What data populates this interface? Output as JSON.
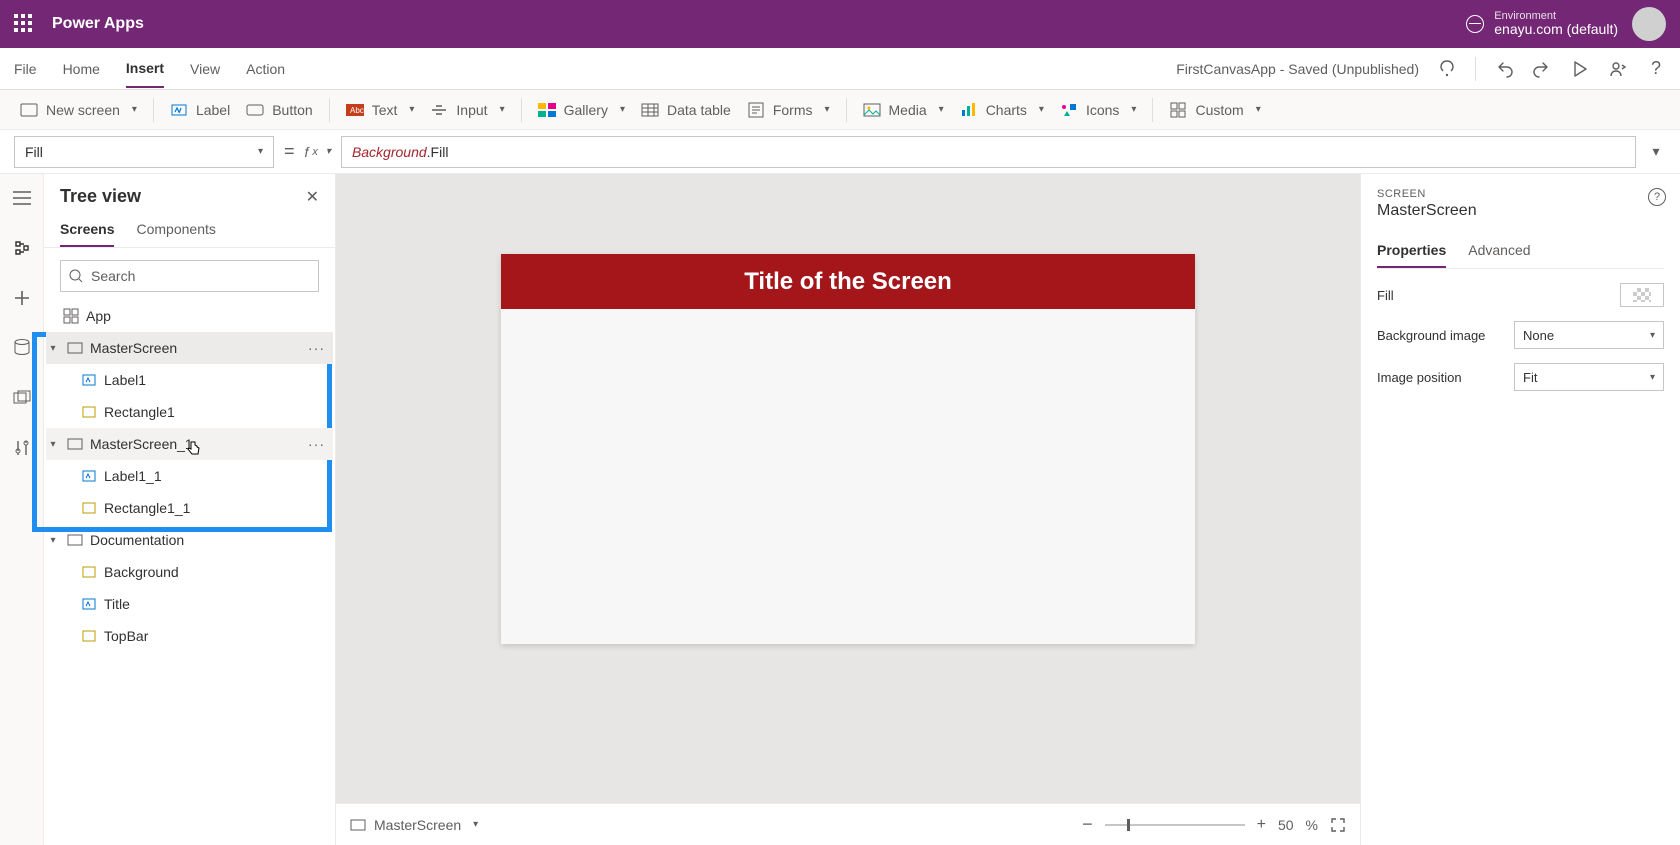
{
  "topbar": {
    "appTitle": "Power Apps",
    "envLabel": "Environment",
    "envName": "enayu.com (default)"
  },
  "menubar": {
    "items": [
      "File",
      "Home",
      "Insert",
      "View",
      "Action"
    ],
    "activeIndex": 2,
    "appStatus": "FirstCanvasApp - Saved (Unpublished)"
  },
  "ribbon": {
    "newScreen": "New screen",
    "label": "Label",
    "button": "Button",
    "text": "Text",
    "input": "Input",
    "gallery": "Gallery",
    "dataTable": "Data table",
    "forms": "Forms",
    "media": "Media",
    "charts": "Charts",
    "icons": "Icons",
    "custom": "Custom"
  },
  "formula": {
    "property": "Fill",
    "exprPart1": "Background",
    "exprPart2": ".Fill"
  },
  "treeview": {
    "title": "Tree view",
    "tabs": [
      "Screens",
      "Components"
    ],
    "activeTab": 0,
    "searchPlaceholder": "Search",
    "nodes": {
      "app": "App",
      "masterScreen": "MasterScreen",
      "label1": "Label1",
      "rectangle1": "Rectangle1",
      "masterScreen1": "MasterScreen_1",
      "label1_1": "Label1_1",
      "rectangle1_1": "Rectangle1_1",
      "documentation": "Documentation",
      "background": "Background",
      "title": "Title",
      "topbar": "TopBar"
    }
  },
  "canvas": {
    "titleText": "Title of the Screen",
    "footerScreen": "MasterScreen",
    "zoomValue": "50",
    "zoomUnit": "%"
  },
  "properties": {
    "kicker": "SCREEN",
    "screenName": "MasterScreen",
    "tabs": [
      "Properties",
      "Advanced"
    ],
    "activeTab": 0,
    "fillLabel": "Fill",
    "bgImageLabel": "Background image",
    "bgImageValue": "None",
    "imgPosLabel": "Image position",
    "imgPosValue": "Fit"
  }
}
